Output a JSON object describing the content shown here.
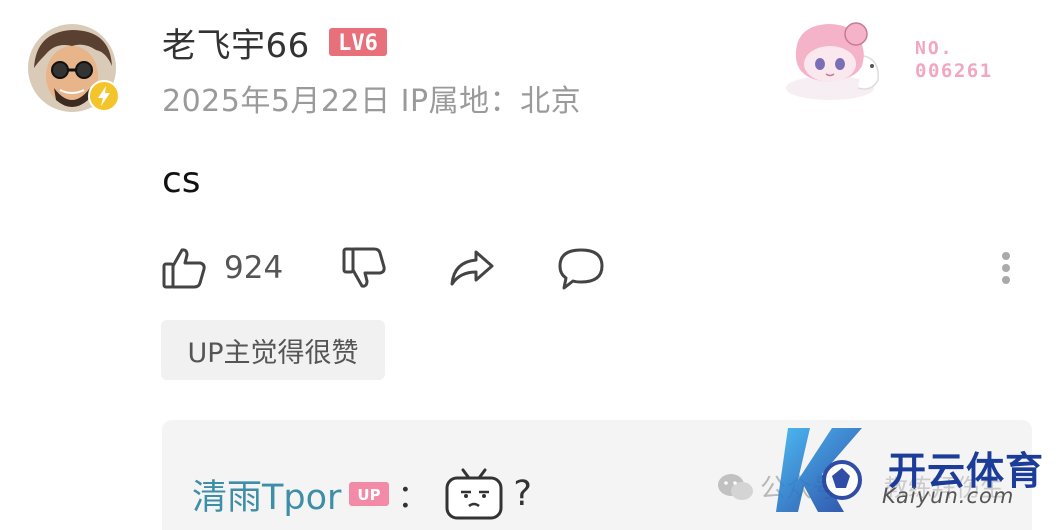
{
  "comment": {
    "username": "老飞宇66",
    "level": "LV6",
    "meta": "2025年5月22日 IP属地：北京",
    "fan_badge": {
      "no_label": "NO.",
      "number": "006261"
    },
    "text": "cs",
    "likes": "924",
    "up_tag": "UP主觉得很赞"
  },
  "reply": {
    "name": "清雨Tpor",
    "badge": "UP",
    "colon": "：",
    "trailing": "?"
  },
  "watermark": {
    "left_text": "公众号",
    "brand": "开云体育",
    "sub": "Kaiyun.com",
    "overlay_text": "教练拜伤生"
  },
  "colors": {
    "level_badge": "#e8707a",
    "fan_number": "#f2a6bf",
    "reply_name": "#3d8ea6",
    "up_badge": "#f28aa8",
    "vip_badge": "#f4c52a"
  },
  "icons": [
    "thumbs-up-icon",
    "thumbs-down-icon",
    "share-icon",
    "reply-icon",
    "more-vertical-icon",
    "lightning-badge-icon",
    "wechat-icon"
  ]
}
